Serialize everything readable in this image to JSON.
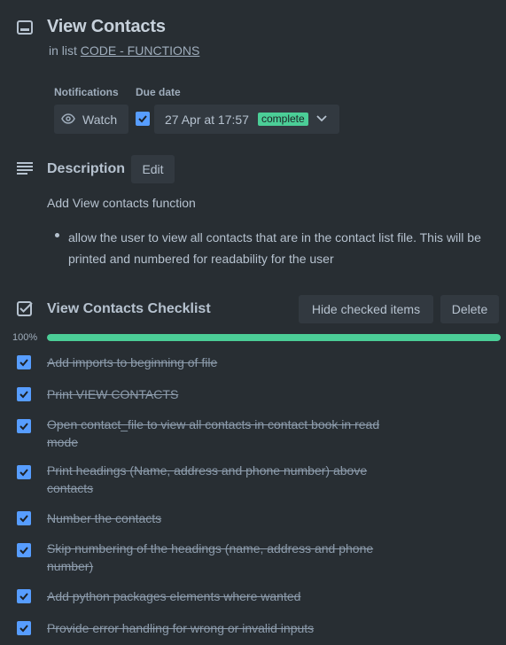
{
  "card": {
    "title": "View Contacts",
    "in_list_prefix": "in list",
    "list_name": "CODE - FUNCTIONS"
  },
  "meta": {
    "notifications_label": "Notifications",
    "watch_label": "Watch",
    "due_label": "Due date",
    "due_date": "27 Apr at 17:57",
    "due_status": "complete"
  },
  "description": {
    "heading": "Description",
    "edit_label": "Edit",
    "text": "Add View contacts function",
    "bullet": "allow the user to view all contacts that are in the contact list file. This will be printed and numbered for readability for the user"
  },
  "checklist": {
    "title": "View Contacts Checklist",
    "hide_label": "Hide checked items",
    "delete_label": "Delete",
    "percent_text": "100%",
    "progress": 1.0,
    "items": [
      {
        "text": "Add imports to beginning of file",
        "checked": true
      },
      {
        "text": "Print VIEW CONTACTS",
        "checked": true
      },
      {
        "text": "Open contact_file to view all contacts in contact book in read mode",
        "checked": true
      },
      {
        "text": "Print headings (Name, address and phone number) above contacts",
        "checked": true
      },
      {
        "text": "Number the contacts",
        "checked": true
      },
      {
        "text": "Skip numbering of the headings (name, address and phone number)",
        "checked": true
      },
      {
        "text": "Add python packages elements where wanted",
        "checked": true
      },
      {
        "text": "Provide error handling for wrong or invalid inputs",
        "checked": true
      }
    ]
  },
  "colors": {
    "background": "#282e33",
    "accent_blue": "#579dff",
    "success_green": "#4bce97"
  }
}
